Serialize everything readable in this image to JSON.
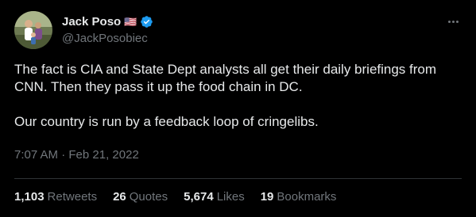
{
  "author": {
    "display_name": "Jack Poso",
    "flag_emoji": "🇺🇸",
    "handle": "@JackPosobiec",
    "verified": true,
    "avatar_icon": "profile-photo"
  },
  "tweet": {
    "paragraphs": [
      "The fact is CIA and State Dept analysts all get their daily briefings from CNN. Then they pass it up the food chain in DC.",
      "Our country is run by a feedback loop of cringelibs."
    ],
    "time": "7:07 AM",
    "separator": "·",
    "date": "Feb 21, 2022"
  },
  "stats": {
    "retweets_count": "1,103",
    "retweets_label": "Retweets",
    "quotes_count": "26",
    "quotes_label": "Quotes",
    "likes_count": "5,674",
    "likes_label": "Likes",
    "bookmarks_count": "19",
    "bookmarks_label": "Bookmarks"
  },
  "colors": {
    "background": "#000000",
    "text_primary": "#e7e9ea",
    "text_secondary": "#71767b",
    "verified_blue": "#1d9bf0",
    "divider": "#2f3336"
  },
  "icons": {
    "more": "more-horizontal-icon",
    "verified": "verified-badge-icon"
  }
}
